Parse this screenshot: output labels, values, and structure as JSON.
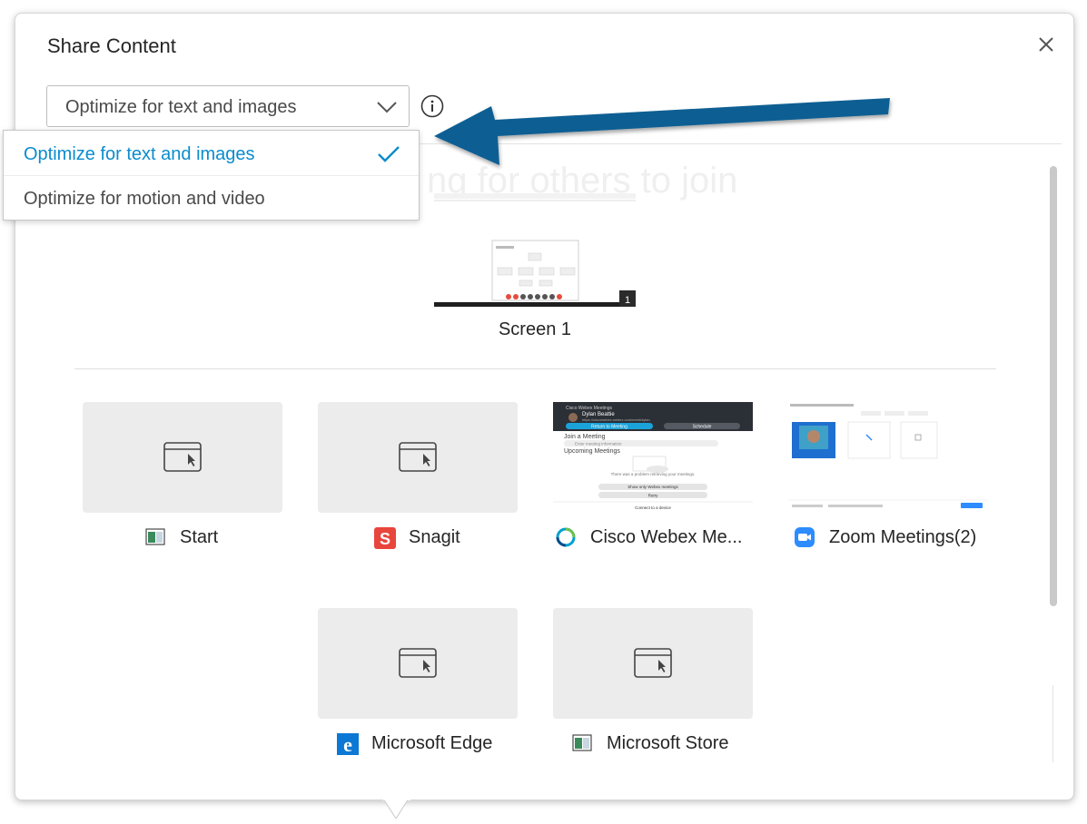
{
  "dialog": {
    "title": "Share Content",
    "close_icon": "close-icon"
  },
  "optimize": {
    "selected": "Optimize for text and images",
    "options": [
      {
        "label": "Optimize for text and images",
        "selected": true
      },
      {
        "label": "Optimize for motion and video",
        "selected": false
      }
    ],
    "info_icon": "info-icon"
  },
  "screens": [
    {
      "label": "Screen 1",
      "badge": "1"
    }
  ],
  "background_text": "ng for others to join",
  "apps": [
    {
      "label": "Start",
      "icon": "app-window-icon",
      "preview": "placeholder"
    },
    {
      "label": "Snagit",
      "icon": "snagit-icon",
      "preview": "placeholder"
    },
    {
      "label": "Cisco Webex Me...",
      "icon": "webex-icon",
      "preview": "webex-window"
    },
    {
      "label": "Zoom Meetings(2)",
      "icon": "zoom-icon",
      "preview": "zoom-window"
    },
    {
      "label": "Microsoft Edge",
      "icon": "edge-icon",
      "preview": "placeholder"
    },
    {
      "label": "Microsoft Store",
      "icon": "app-window-icon",
      "preview": "placeholder"
    }
  ],
  "webex_preview": {
    "header": "Cisco Webex Meetings",
    "user": "Dylan Beattie",
    "url": "https://ciscowebex.webex.com/meet/dylan",
    "return_btn": "Return to Meeting",
    "schedule_btn": "Schedule",
    "join_title": "Join a Meeting",
    "join_placeholder": "Enter meeting information",
    "upcoming_title": "Upcoming Meetings",
    "error_text": "There was a problem retrieving your meetings.",
    "filter_btn": "Show only Webex meetings",
    "retry_btn": "Retry",
    "connect": "Connect to a device"
  },
  "colors": {
    "accent": "#0b8ccd",
    "arrow": "#0d5f93",
    "tile_bg": "#ececec",
    "snagit": "#e8453c",
    "zoom": "#2d8cff",
    "edge": "#0a78d4"
  }
}
